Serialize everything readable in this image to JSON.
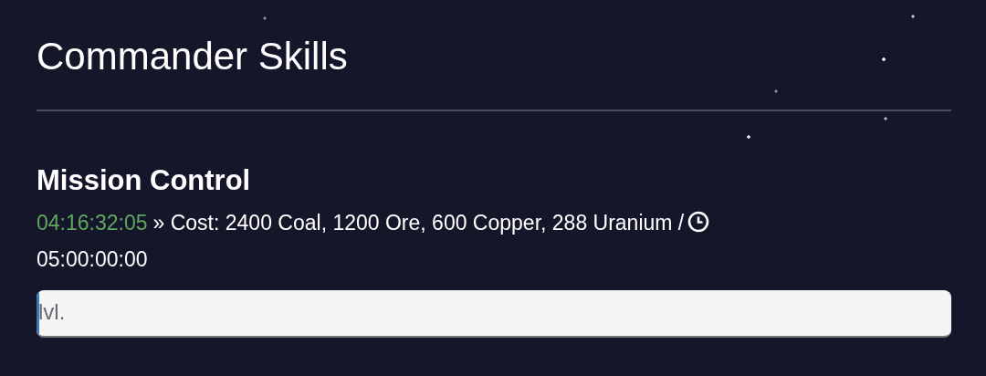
{
  "page": {
    "title": "Commander Skills"
  },
  "skill": {
    "name": "Mission Control",
    "remaining": "04:16:32:05",
    "cost": "» Cost: 2400 Coal, 1200 Ore, 600 Copper, 288 Uranium /",
    "duration": "05:00:00:00",
    "progress": {
      "label": "lvl.",
      "level": 0.003
    }
  }
}
